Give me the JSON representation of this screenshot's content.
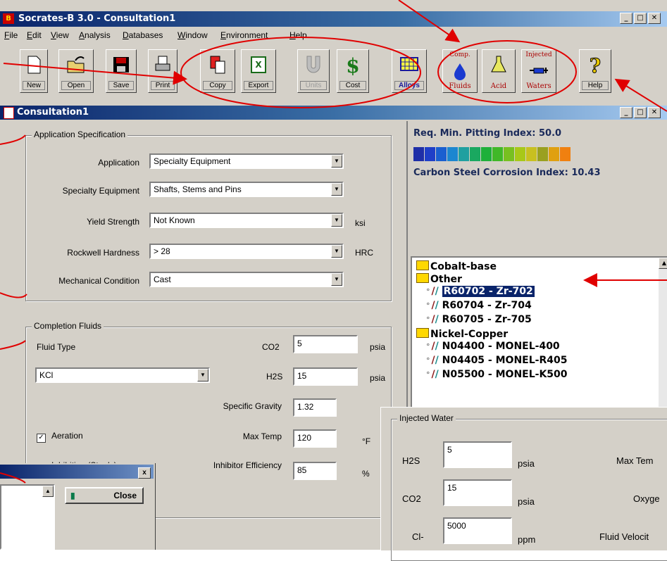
{
  "app": {
    "title": "Socrates-B 3.0 - Consultation1",
    "icon_letter": "B",
    "menu": [
      "File",
      "Edit",
      "View",
      "Analysis",
      "Databases",
      "Window",
      "Environment",
      "Help"
    ],
    "toolbar": [
      {
        "label": "New",
        "icon": "new-document-icon",
        "enabled": true
      },
      {
        "label": "Open",
        "icon": "open-folder-icon",
        "enabled": true
      },
      {
        "label": "Save",
        "icon": "floppy-disk-icon",
        "enabled": true
      },
      {
        "label": "Print",
        "icon": "printer-icon",
        "enabled": true
      },
      {
        "label": "Copy",
        "icon": "copy-icon",
        "enabled": true
      },
      {
        "label": "Export",
        "icon": "excel-export-icon",
        "enabled": true
      },
      {
        "label": "Units",
        "icon": "magnet-icon",
        "enabled": false
      },
      {
        "label": "Cost",
        "icon": "dollar-icon",
        "enabled": true
      },
      {
        "label": "Alloys",
        "icon": "alloys-grid-icon",
        "enabled": true
      },
      {
        "label": "Fluids",
        "icon": "comp-fluids-icon",
        "enabled": true,
        "top_text": "Comp."
      },
      {
        "label": "Acid",
        "icon": "flask-icon",
        "enabled": true
      },
      {
        "label": "Waters",
        "icon": "injected-waters-icon",
        "enabled": true,
        "top_text": "Injected"
      },
      {
        "label": "Help",
        "icon": "help-icon",
        "enabled": true
      }
    ]
  },
  "consultation": {
    "title": "Consultation1",
    "application_spec": {
      "title": "Application Specification",
      "application": {
        "label": "Application",
        "value": "Specialty Equipment"
      },
      "specialty_equipment": {
        "label": "Specialty Equipment",
        "value": "Shafts, Stems and Pins"
      },
      "yield_strength": {
        "label": "Yield Strength",
        "value": "Not Known",
        "unit": "ksi"
      },
      "rockwell_hardness": {
        "label": "Rockwell Hardness",
        "value": "> 28",
        "unit": "HRC"
      },
      "mechanical_condition": {
        "label": "Mechanical Condition",
        "value": "Cast"
      }
    },
    "completion_fluids": {
      "title": "Completion Fluids",
      "fluid_type_label": "Fluid Type",
      "fluid_type_value": "KCl",
      "co2": {
        "label": "CO2",
        "value": "5",
        "unit": "psia"
      },
      "h2s": {
        "label": "H2S",
        "value": "15",
        "unit": "psia"
      },
      "specific_gravity": {
        "label": "Specific Gravity",
        "value": "1.32"
      },
      "max_temp": {
        "label": "Max Temp",
        "value": "120",
        "unit": "°F"
      },
      "inhibitor_efficiency": {
        "label": "Inhibitor Efficiency",
        "value": "85",
        "unit": "%"
      },
      "aeration": {
        "label": "Aeration",
        "checked": true
      },
      "inhibition": {
        "label": "Inhibition (Steels)",
        "checked": true
      }
    },
    "indices": {
      "pitting": "Req. Min. Pitting Index: 50.0",
      "corrosion": "Carbon Steel Corrosion Index: 10.43"
    },
    "color_scale": [
      "#1f2fa8",
      "#1f3fc8",
      "#1a5fd0",
      "#1c86d0",
      "#20a0a0",
      "#1aa860",
      "#1eb03a",
      "#40b828",
      "#78c020",
      "#a8c818",
      "#c8c020",
      "#9aa020",
      "#e0a010",
      "#f08010"
    ],
    "tree": [
      {
        "type": "folder",
        "label": "Cobalt-base",
        "open": false
      },
      {
        "type": "folder",
        "label": "Other",
        "open": true
      },
      {
        "type": "alloy",
        "label": "R60702 - Zr-702",
        "selected": true
      },
      {
        "type": "alloy",
        "label": "R60704 - Zr-704"
      },
      {
        "type": "alloy",
        "label": "R60705 - Zr-705"
      },
      {
        "type": "folder",
        "label": "Nickel-Copper",
        "open": true
      },
      {
        "type": "alloy",
        "label": "N04400 - MONEL-400"
      },
      {
        "type": "alloy",
        "label": "N04405 - MONEL-R405"
      },
      {
        "type": "alloy",
        "label": "N05500 - MONEL-K500"
      }
    ]
  },
  "injected_water": {
    "title": "Injected Water",
    "h2s": {
      "label": "H2S",
      "value": "5",
      "unit": "psia"
    },
    "co2": {
      "label": "CO2",
      "value": "15",
      "unit": "psia"
    },
    "cl": {
      "label": "Cl-",
      "value": "5000",
      "unit": "ppm"
    },
    "max_temp_label": "Max Tem",
    "oxygen_label": "Oxyge",
    "fluid_velocity_label": "Fluid Velocit"
  },
  "dialog": {
    "close_label": "Close",
    "x_label": "x"
  }
}
